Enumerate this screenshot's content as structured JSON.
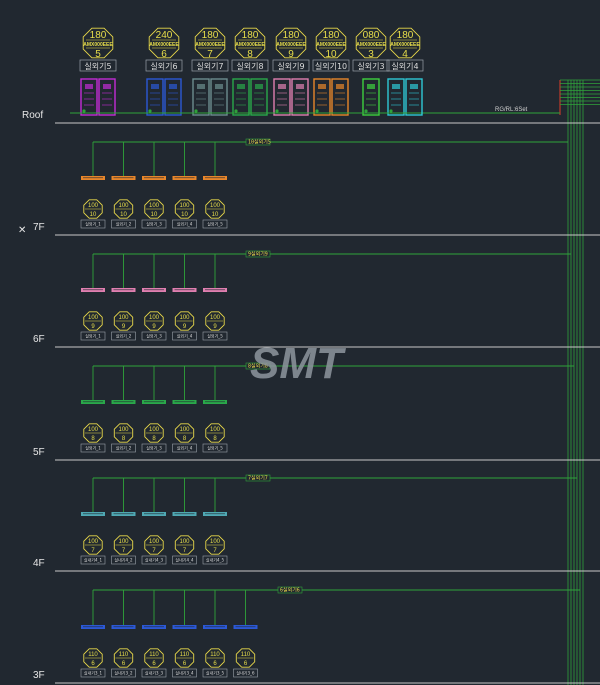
{
  "colors": {
    "background": "#212830",
    "pipe": "#2fa33a",
    "floor_line": "#c9c9c9",
    "tag": "#e8d84a",
    "riser": "#c0392b"
  },
  "roof": {
    "label": "Roof",
    "riser_ref": "RG/RL:6Set",
    "outdoor_units": [
      {
        "top": "180",
        "mid": "AMX000EEE",
        "num": "5",
        "label": "실외기5",
        "color": "#c32bd6"
      },
      {
        "top": "240",
        "mid": "AMX000EEE",
        "num": "6",
        "label": "실외기6",
        "color": "#2b58d6"
      },
      {
        "top": "180",
        "mid": "AMX000EEE",
        "num": "7",
        "label": "실외기7",
        "color": "#6c8d8f"
      },
      {
        "top": "180",
        "mid": "AMX000EEE",
        "num": "8",
        "label": "실외기8",
        "color": "#2aa84a"
      },
      {
        "top": "180",
        "mid": "AMX000EEE",
        "num": "9",
        "label": "실외기9",
        "color": "#e07fb0"
      },
      {
        "top": "180",
        "mid": "AMX000EEE",
        "num": "10",
        "label": "실외기10",
        "color": "#e8862a"
      },
      {
        "top": "080",
        "mid": "AMX000EEE",
        "num": "3",
        "label": "실외기3",
        "color": "#3ed13e"
      },
      {
        "top": "180",
        "mid": "AMX000EEE",
        "num": "4",
        "label": "실외기4",
        "color": "#2ec9d6"
      }
    ]
  },
  "floors": [
    {
      "label": "7F",
      "marker": "✕",
      "color": "#e8862a",
      "tag": "10실외기5",
      "units": 5,
      "indoor": [
        {
          "cap": "100",
          "num": "10",
          "label": "실외기_1"
        },
        {
          "cap": "100",
          "num": "10",
          "label": "실외기_2"
        },
        {
          "cap": "100",
          "num": "10",
          "label": "실외기_3"
        },
        {
          "cap": "100",
          "num": "10",
          "label": "실외기_4"
        },
        {
          "cap": "100",
          "num": "10",
          "label": "실외기_5"
        }
      ]
    },
    {
      "label": "6F",
      "marker": "",
      "color": "#e07fb0",
      "tag": "9실외기9",
      "units": 5,
      "indoor": [
        {
          "cap": "100",
          "num": "9",
          "label": "실외기_1"
        },
        {
          "cap": "100",
          "num": "9",
          "label": "실외기_2"
        },
        {
          "cap": "100",
          "num": "9",
          "label": "실외기_3"
        },
        {
          "cap": "100",
          "num": "9",
          "label": "실외기_4"
        },
        {
          "cap": "100",
          "num": "9",
          "label": "실외기_5"
        }
      ]
    },
    {
      "label": "5F",
      "marker": "",
      "color": "#2aa84a",
      "tag": "8실외기8",
      "units": 5,
      "indoor": [
        {
          "cap": "100",
          "num": "8",
          "label": "실외기_1"
        },
        {
          "cap": "100",
          "num": "8",
          "label": "실외기_2"
        },
        {
          "cap": "100",
          "num": "8",
          "label": "실외기_3"
        },
        {
          "cap": "100",
          "num": "8",
          "label": "실외기_4"
        },
        {
          "cap": "100",
          "num": "8",
          "label": "실외기_5"
        }
      ]
    },
    {
      "label": "4F",
      "marker": "",
      "color": "#4fa8b3",
      "tag": "7실외기7",
      "units": 5,
      "indoor": [
        {
          "cap": "100",
          "num": "7",
          "label": "실내기4_1"
        },
        {
          "cap": "100",
          "num": "7",
          "label": "실내기4_2"
        },
        {
          "cap": "100",
          "num": "7",
          "label": "실내기4_3"
        },
        {
          "cap": "100",
          "num": "7",
          "label": "실내기4_4"
        },
        {
          "cap": "100",
          "num": "7",
          "label": "실내기4_5"
        }
      ]
    },
    {
      "label": "3F",
      "marker": "",
      "color": "#2b58d6",
      "tag": "6실외기6",
      "units": 6,
      "indoor": [
        {
          "cap": "110",
          "num": "6",
          "label": "실내기3_1"
        },
        {
          "cap": "110",
          "num": "6",
          "label": "실내기3_2"
        },
        {
          "cap": "110",
          "num": "6",
          "label": "실내기3_3"
        },
        {
          "cap": "110",
          "num": "6",
          "label": "실내기3_4"
        },
        {
          "cap": "110",
          "num": "6",
          "label": "실내기3_5"
        },
        {
          "cap": "110",
          "num": "6",
          "label": "실내기3_6"
        }
      ]
    }
  ],
  "watermark": {
    "text": "SMT"
  }
}
